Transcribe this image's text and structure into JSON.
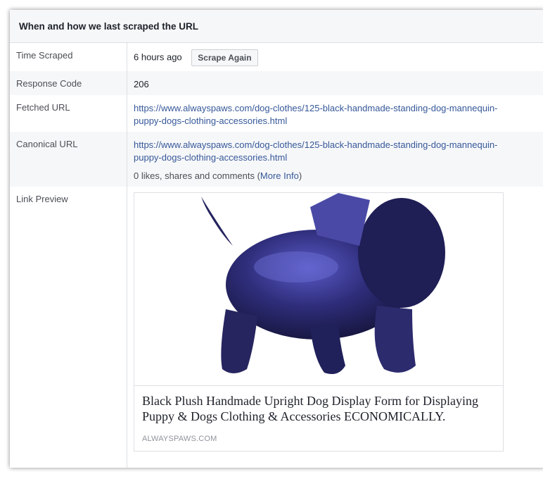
{
  "header": {
    "title": "When and how we last scraped the URL"
  },
  "rows": {
    "time_scraped": {
      "label": "Time Scraped",
      "value": "6 hours ago",
      "button": "Scrape Again"
    },
    "response_code": {
      "label": "Response Code",
      "value": "206"
    },
    "fetched_url": {
      "label": "Fetched URL",
      "line1": "https://www.alwayspaws.com/dog-clothes/125-black-handmade-standing-dog-mannequin-",
      "line2": "puppy-dogs-clothing-accessories.html"
    },
    "canonical_url": {
      "label": "Canonical URL",
      "line1": "https://www.alwayspaws.com/dog-clothes/125-black-handmade-standing-dog-mannequin-",
      "line2": "puppy-dogs-clothing-accessories.html",
      "engagement_prefix": "0 likes, shares and comments (",
      "more_info": "More Info",
      "engagement_suffix": ")"
    },
    "link_preview": {
      "label": "Link Preview",
      "title": "Black Plush Handmade Upright Dog Display Form for Displaying Puppy & Dogs Clothing & Accessories ECONOMICALLY.",
      "domain": "ALWAYSPAWS.COM"
    }
  },
  "colors": {
    "link": "#365899",
    "header_bg": "#f6f7f9",
    "border": "#dddfe2",
    "dog": "#2b2a66"
  }
}
